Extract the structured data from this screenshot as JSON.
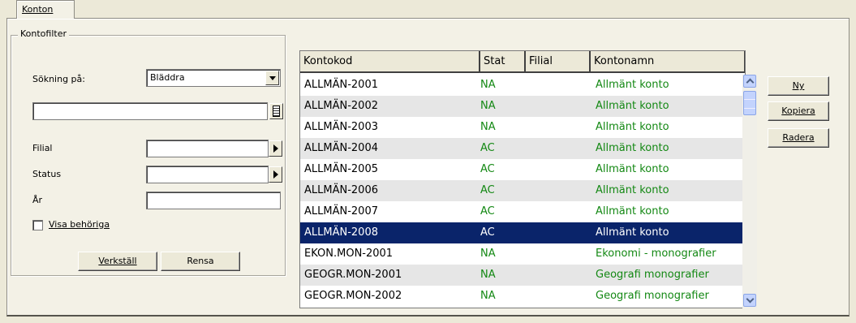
{
  "tab": {
    "label": "Konton"
  },
  "filter": {
    "legend": "Kontofilter",
    "search_label": "Sökning på:",
    "search_value": "Bläddra",
    "search_text": "",
    "filial_label": "Filial",
    "status_label": "Status",
    "year_label": "År",
    "show_authorized_label": "Visa behöriga",
    "apply_label": "Verkställ",
    "clear_label": "Rensa"
  },
  "grid": {
    "columns": [
      "Kontokod",
      "Stat",
      "Filial",
      "Kontonamn"
    ],
    "rows": [
      {
        "kod": "ALLMÄN-2001",
        "stat": "NA",
        "filial": "",
        "namn": "Allmänt konto"
      },
      {
        "kod": "ALLMÄN-2002",
        "stat": "NA",
        "filial": "",
        "namn": "Allmänt konto"
      },
      {
        "kod": "ALLMÄN-2003",
        "stat": "NA",
        "filial": "",
        "namn": "Allmänt konto"
      },
      {
        "kod": "ALLMÄN-2004",
        "stat": "AC",
        "filial": "",
        "namn": "Allmänt konto"
      },
      {
        "kod": "ALLMÄN-2005",
        "stat": "AC",
        "filial": "",
        "namn": "Allmänt konto"
      },
      {
        "kod": "ALLMÄN-2006",
        "stat": "AC",
        "filial": "",
        "namn": "Allmänt konto"
      },
      {
        "kod": "ALLMÄN-2007",
        "stat": "AC",
        "filial": "",
        "namn": "Allmänt konto"
      },
      {
        "kod": "ALLMÄN-2008",
        "stat": "AC",
        "filial": "",
        "namn": "Allmänt konto"
      },
      {
        "kod": "EKON.MON-2001",
        "stat": "NA",
        "filial": "",
        "namn": "Ekonomi - monografier"
      },
      {
        "kod": "GEOGR.MON-2001",
        "stat": "NA",
        "filial": "",
        "namn": "Geografi monografier"
      },
      {
        "kod": "GEOGR.MON-2002",
        "stat": "NA",
        "filial": "",
        "namn": "Geografi monografier"
      }
    ],
    "selected_index": 7
  },
  "actions": {
    "new_label": "Ny",
    "copy_label": "Kopiera",
    "delete_label": "Radera"
  },
  "colors": {
    "selection": "#0a246a",
    "status_text": "#138813",
    "background": "#ece9d8"
  }
}
